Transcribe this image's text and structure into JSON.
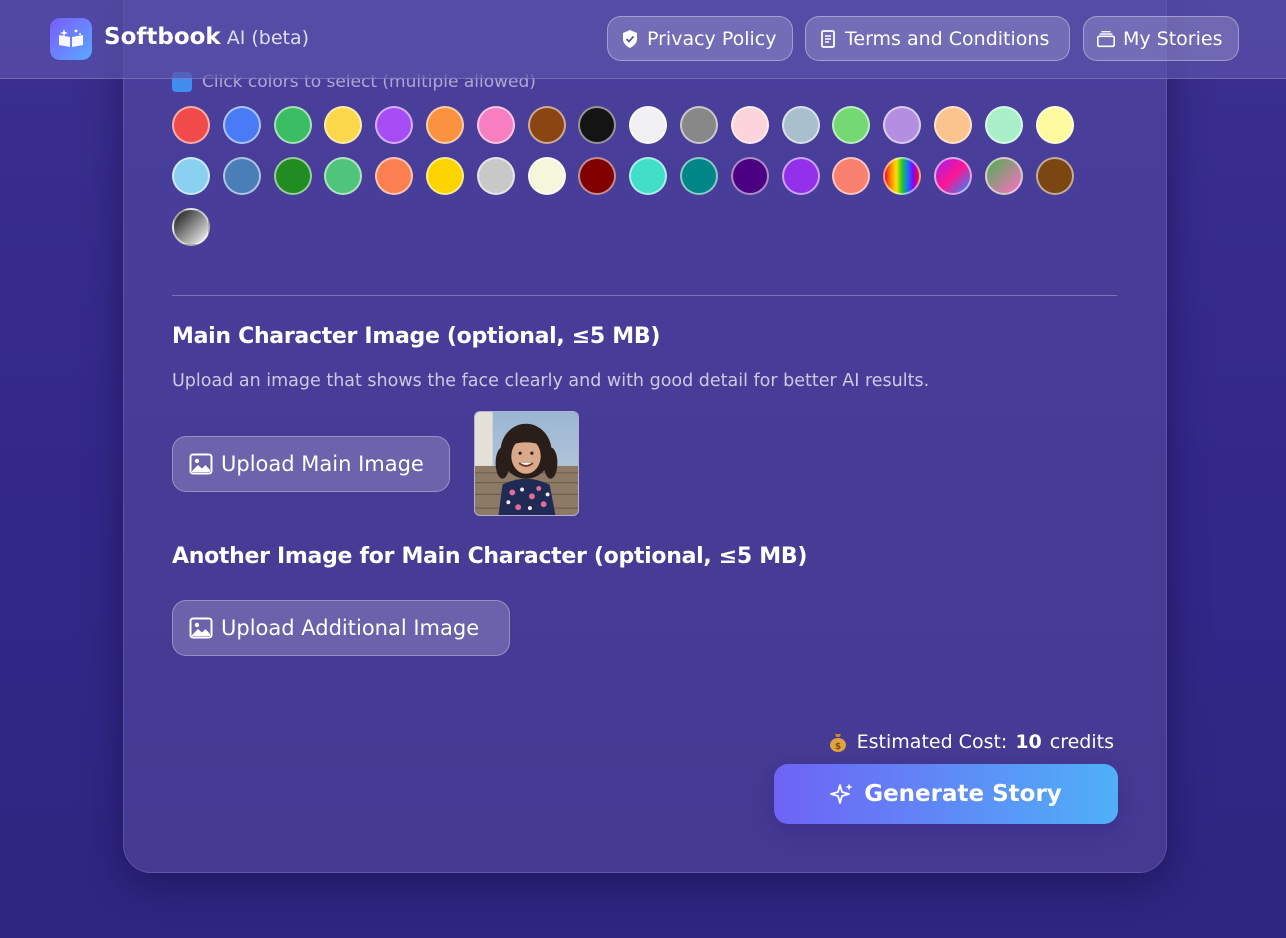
{
  "header": {
    "brand": "Softbook",
    "brand_suffix": "AI (beta)",
    "nav": {
      "privacy": "Privacy Policy",
      "terms": "Terms and Conditions",
      "stories": "My Stories"
    }
  },
  "colors": {
    "hint": "Click colors to select (multiple allowed)",
    "swatches": [
      {
        "name": "red",
        "fill": "#f14a4a"
      },
      {
        "name": "blue",
        "fill": "#4a7bf7"
      },
      {
        "name": "green",
        "fill": "#3bbd63"
      },
      {
        "name": "yellow",
        "fill": "#fbd84a"
      },
      {
        "name": "purple",
        "fill": "#a64df5"
      },
      {
        "name": "orange",
        "fill": "#fb923f"
      },
      {
        "name": "pink",
        "fill": "#f77ec0"
      },
      {
        "name": "brown",
        "fill": "#8b4512"
      },
      {
        "name": "black",
        "fill": "#141414"
      },
      {
        "name": "white",
        "fill": "#f1f1f4"
      },
      {
        "name": "gray",
        "fill": "#888888"
      },
      {
        "name": "light-pink",
        "fill": "#fbd4dc"
      },
      {
        "name": "light-blue-gray",
        "fill": "#aabfcd"
      },
      {
        "name": "light-green",
        "fill": "#74d874"
      },
      {
        "name": "lavender",
        "fill": "#b48ee0"
      },
      {
        "name": "peach",
        "fill": "#fbc48e"
      },
      {
        "name": "mint",
        "fill": "#a9f0c8"
      },
      {
        "name": "light-yellow",
        "fill": "#fdfaa0"
      },
      {
        "name": "sky-blue",
        "fill": "#8ad0f0"
      },
      {
        "name": "steel-blue",
        "fill": "#4a7eb8"
      },
      {
        "name": "forest-green",
        "fill": "#218c21"
      },
      {
        "name": "emerald",
        "fill": "#4fc47a"
      },
      {
        "name": "coral",
        "fill": "#fb7f50"
      },
      {
        "name": "gold",
        "fill": "#fdd300"
      },
      {
        "name": "silver",
        "fill": "#c8c8c8"
      },
      {
        "name": "cream",
        "fill": "#f6f6dc"
      },
      {
        "name": "maroon",
        "fill": "#800000"
      },
      {
        "name": "turquoise",
        "fill": "#41dec8"
      },
      {
        "name": "teal",
        "fill": "#008686"
      },
      {
        "name": "indigo",
        "fill": "#4b0082"
      },
      {
        "name": "violet",
        "fill": "#9230ec"
      },
      {
        "name": "salmon",
        "fill": "#fa8070"
      },
      {
        "name": "rainbow",
        "fill": "linear-gradient(90deg,#e11,#f80,#fd0,#2c2,#17f,#80f,#e11)"
      },
      {
        "name": "magenta-gradient",
        "fill": "linear-gradient(135deg,#a020f0 0%,#ff1493 50%,#1e90ff 100%)"
      },
      {
        "name": "green-pink-gradient",
        "fill": "linear-gradient(135deg,#4caf50 0%,#ff6ec7 100%)"
      },
      {
        "name": "chocolate",
        "fill": "#7a4612"
      },
      {
        "name": "black-white-gradient",
        "fill": "linear-gradient(135deg,#111 0%,#fff 100%)"
      }
    ]
  },
  "main_image": {
    "title": "Main Character Image (optional, ≤5 MB)",
    "description": "Upload an image that shows the face clearly and with good detail for better AI results.",
    "upload_label": "Upload Main Image"
  },
  "additional_image": {
    "title": "Another Image for Main Character (optional, ≤5 MB)",
    "upload_label": "Upload Additional Image"
  },
  "cost": {
    "label": "Estimated Cost:",
    "amount": "10",
    "unit": "credits"
  },
  "generate_label": "Generate Story"
}
